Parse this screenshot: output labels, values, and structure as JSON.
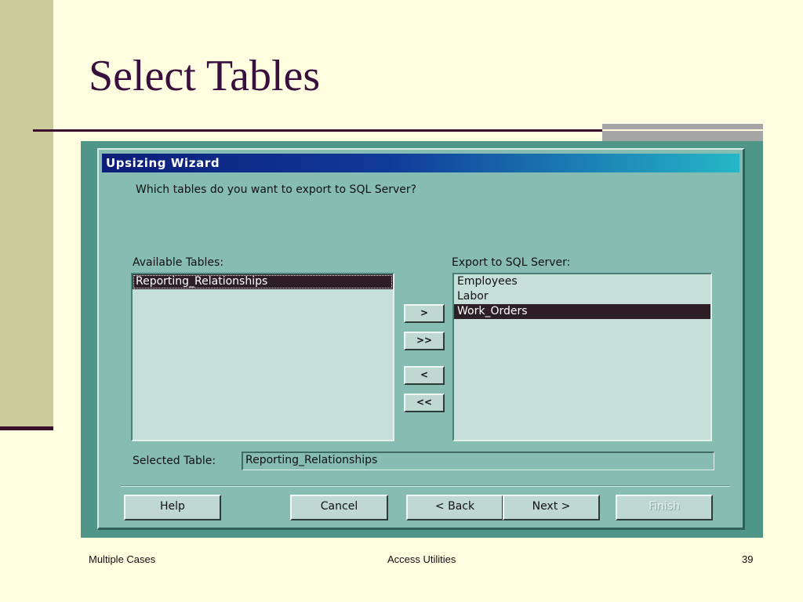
{
  "slide": {
    "title": "Select Tables",
    "footer_left": "Multiple Cases",
    "footer_center": "Access Utilities",
    "page_number": "39"
  },
  "dialog": {
    "title": "Upsizing  Wizard",
    "question": "Which tables do you want to export to SQL Server?",
    "available_label": "Available Tables:",
    "available_items": [
      {
        "label": "Reporting_Relationships",
        "selected": true
      }
    ],
    "export_label": "Export to SQL Server:",
    "export_items": [
      {
        "label": "Employees",
        "selected": false
      },
      {
        "label": "Labor",
        "selected": false
      },
      {
        "label": "Work_Orders",
        "selected": true
      }
    ],
    "move_buttons": {
      "add": ">",
      "add_all": ">>",
      "remove": "<",
      "remove_all": "<<"
    },
    "selected_table_label": "Selected Table:",
    "selected_table_value": "Reporting_Relationships",
    "buttons": {
      "help": "Help",
      "cancel": "Cancel",
      "back": "< Back",
      "next": "Next >",
      "finish": "Finish"
    }
  }
}
